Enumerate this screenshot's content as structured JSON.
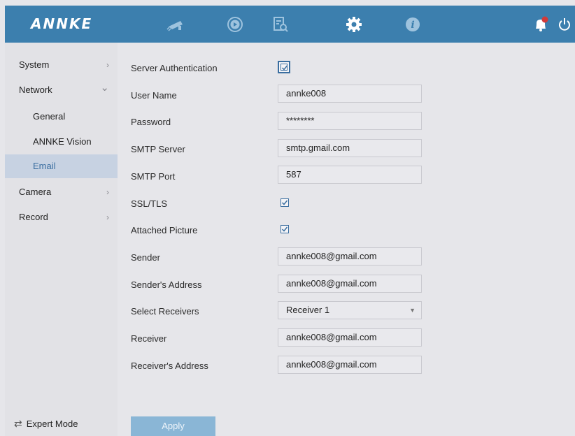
{
  "header": {
    "logo": "ANNKE",
    "nav_icons": [
      "camera-icon",
      "playback-icon",
      "search-icon",
      "settings-gear-icon",
      "info-icon"
    ],
    "right_icons": [
      "notification-bell-icon",
      "power-icon"
    ],
    "accent_color": "#3c7fae"
  },
  "sidebar": {
    "items": [
      {
        "label": "System",
        "chevron": "›"
      },
      {
        "label": "Network",
        "chevron": "⌄"
      },
      {
        "label": "General"
      },
      {
        "label": "ANNKE Vision"
      },
      {
        "label": "Email"
      },
      {
        "label": "Camera",
        "chevron": "›"
      },
      {
        "label": "Record",
        "chevron": "›"
      }
    ],
    "selected": "Email",
    "expert_mode": "Expert Mode"
  },
  "form": {
    "server_auth": {
      "label": "Server Authentication",
      "checked": true
    },
    "user_name": {
      "label": "User Name",
      "value": "annke008"
    },
    "password": {
      "label": "Password",
      "value": "********"
    },
    "smtp_server": {
      "label": "SMTP Server",
      "value": "smtp.gmail.com"
    },
    "smtp_port": {
      "label": "SMTP Port",
      "value": "587"
    },
    "ssl_tls": {
      "label": "SSL/TLS",
      "checked": true
    },
    "attached_picture": {
      "label": "Attached Picture",
      "checked": true
    },
    "sender": {
      "label": "Sender",
      "value": "annke008@gmail.com"
    },
    "sender_address": {
      "label": "Sender's Address",
      "value": "annke008@gmail.com"
    },
    "select_receivers": {
      "label": "Select Receivers",
      "value": "Receiver 1"
    },
    "receiver": {
      "label": "Receiver",
      "value": "annke008@gmail.com"
    },
    "receiver_address": {
      "label": "Receiver's Address",
      "value": "annke008@gmail.com"
    }
  },
  "apply_label": "Apply"
}
